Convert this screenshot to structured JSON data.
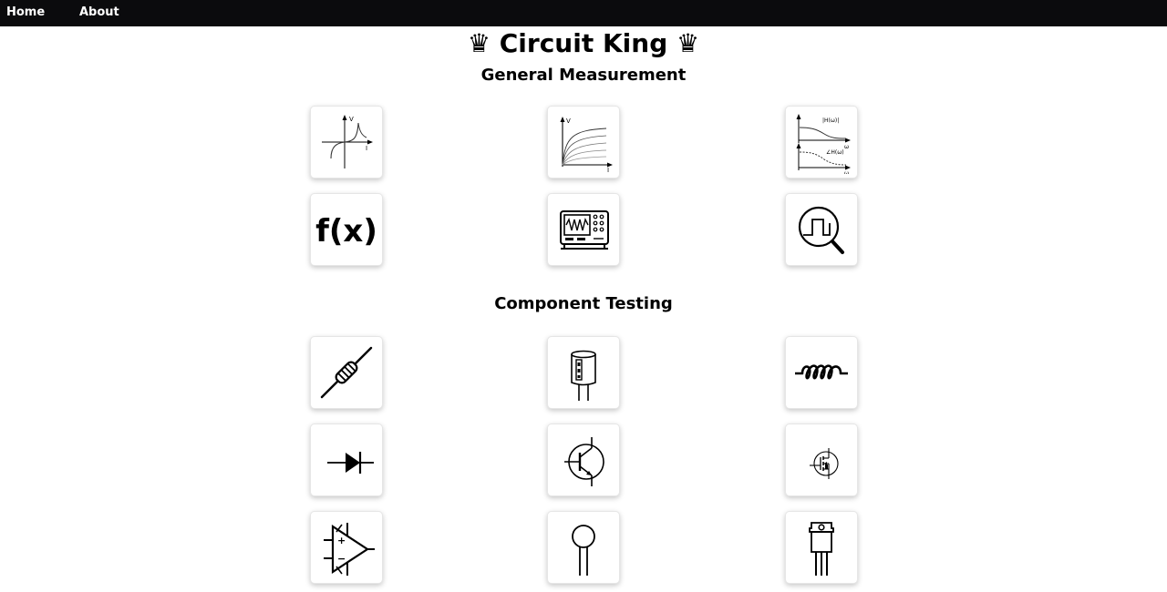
{
  "nav": {
    "home_label": "Home",
    "about_label": "About"
  },
  "header": {
    "title": "♛ Circuit King ♛"
  },
  "sections": {
    "general": {
      "title": "General Measurement"
    },
    "components": {
      "title": "Component Testing"
    }
  },
  "icon_text": {
    "v": "V",
    "i": "I",
    "h_mag": "|H(ω)|",
    "h_phase": "∠H(ω)",
    "omega": "ω",
    "fx": "f(x)",
    "plus": "+",
    "minus": "−"
  }
}
